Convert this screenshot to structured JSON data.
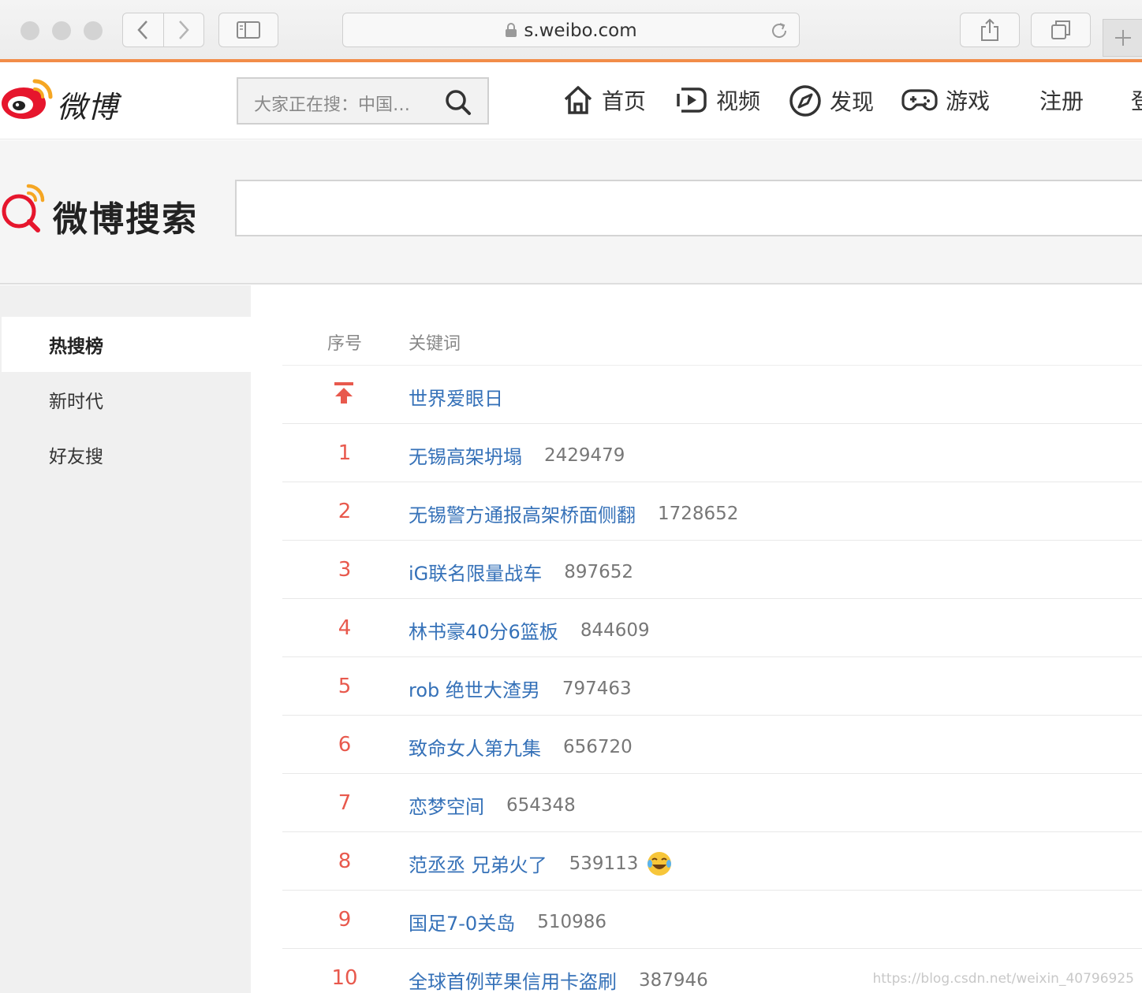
{
  "browser": {
    "url": "s.weibo.com"
  },
  "topnav": {
    "brand": "微博",
    "search_placeholder": "大家正在搜：中国…",
    "items": [
      {
        "label": "首页",
        "icon": "home-icon"
      },
      {
        "label": "视频",
        "icon": "video-icon"
      },
      {
        "label": "发现",
        "icon": "compass-icon"
      },
      {
        "label": "游戏",
        "icon": "gamepad-icon"
      }
    ],
    "register": "注册",
    "login_partial": "登"
  },
  "banner": {
    "title": "微博搜索",
    "search_value": ""
  },
  "sidebar": {
    "items": [
      {
        "label": "热搜榜",
        "active": true
      },
      {
        "label": "新时代",
        "active": false
      },
      {
        "label": "好友搜",
        "active": false
      }
    ]
  },
  "table": {
    "headers": {
      "rank": "序号",
      "keyword": "关键词"
    },
    "pinned": {
      "keyword": "世界爱眼日"
    },
    "rows": [
      {
        "rank": "1",
        "keyword": "无锡高架坍塌",
        "count": "2429479"
      },
      {
        "rank": "2",
        "keyword": "无锡警方通报高架桥面侧翻",
        "count": "1728652"
      },
      {
        "rank": "3",
        "keyword": "iG联名限量战车",
        "count": "897652"
      },
      {
        "rank": "4",
        "keyword": "林书豪40分6篮板",
        "count": "844609"
      },
      {
        "rank": "5",
        "keyword": "rob 绝世大渣男",
        "count": "797463"
      },
      {
        "rank": "6",
        "keyword": "致命女人第九集",
        "count": "656720"
      },
      {
        "rank": "7",
        "keyword": "恋梦空间",
        "count": "654348"
      },
      {
        "rank": "8",
        "keyword": "范丞丞 兄弟火了",
        "count": "539113",
        "emoji": "laughing-tears-icon"
      },
      {
        "rank": "9",
        "keyword": "国足7-0关岛",
        "count": "510986"
      },
      {
        "rank": "10",
        "keyword": "全球首例苹果信用卡盗刷",
        "count": "387946"
      }
    ]
  },
  "watermark": "https://blog.csdn.net/weixin_40796925",
  "colors": {
    "accent_orange": "#f28c48",
    "rank_red": "#e8594d",
    "link_blue": "#3571b8",
    "weibo_red": "#e6162d"
  }
}
